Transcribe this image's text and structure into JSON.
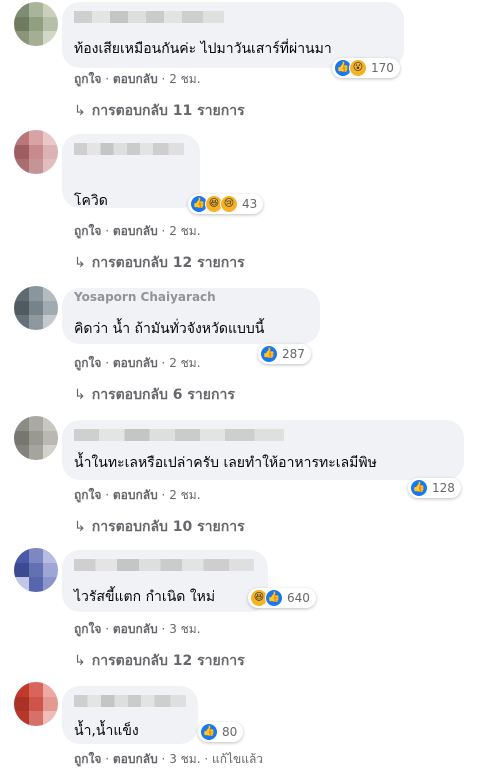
{
  "comments": [
    {
      "avatar_colors": [
        "#7d8c72",
        "#a8b59a",
        "#c9d1bd",
        "#6f7b5e",
        "#90a07f",
        "#b6c0a8",
        "#8a9579",
        "#a3ae93",
        "#d1d8c6"
      ],
      "name": "",
      "text": "ท้องเสียเหมือนกันค่ะ ไปมาวันเสาร์ที่ผ่านมา",
      "reactions": [
        "like",
        "wow"
      ],
      "reaction_count": "170",
      "like_label": "ถูกใจ",
      "reply_label": "ตอบกลับ",
      "time": "2 ชม.",
      "edited": "",
      "replies": "การตอบกลับ 11 รายการ"
    },
    {
      "avatar_colors": [
        "#b9777a",
        "#d9a3a5",
        "#e8c8c9",
        "#9d5d61",
        "#c98a8d",
        "#dcb3b4",
        "#a86e70",
        "#c49496",
        "#e2bebf"
      ],
      "name": "",
      "text": "โควิด",
      "reactions": [
        "like",
        "haha",
        "sad"
      ],
      "reaction_count": "43",
      "like_label": "ถูกใจ",
      "reply_label": "ตอบกลับ",
      "time": "2 ชม.",
      "edited": "",
      "replies": "การตอบกลับ 12 รายการ"
    },
    {
      "avatar_colors": [
        "#5f6b73",
        "#8a969d",
        "#b4bcc1",
        "#4f5a61",
        "#77838a",
        "#a0aab0",
        "#65717a",
        "#8e999f",
        "#c3c9cd"
      ],
      "name": "Yosaporn Chaiyarach",
      "text": "คิดว่า น้ำ ถ้ามันทั่วจังหวัดแบบนี้",
      "reactions": [
        "like"
      ],
      "reaction_count": "287",
      "like_label": "ถูกใจ",
      "reply_label": "ตอบกลับ",
      "time": "2 ชม.",
      "edited": "",
      "replies": "การตอบกลับ 6 รายการ"
    },
    {
      "avatar_colors": [
        "#8c8c86",
        "#aaa9a2",
        "#c8c7c0",
        "#77766f",
        "#9a9991",
        "#b9b8b1",
        "#83827b",
        "#a5a49d",
        "#d2d1cb"
      ],
      "name": "",
      "text": "น้ำในทะเลหรือเปล่าครับ เลยทำให้อาหารทะเลมีพิษ",
      "reactions": [
        "like"
      ],
      "reaction_count": "128",
      "like_label": "ถูกใจ",
      "reply_label": "ตอบกลับ",
      "time": "2 ชม.",
      "edited": "",
      "replies": "การตอบกลับ 10 รายการ"
    },
    {
      "avatar_colors": [
        "#4a5aa8",
        "#7d87c2",
        "#b7bde0",
        "#3c4a8f",
        "#6270b4",
        "#9ea6d4",
        "#c2c7e6",
        "#5866ad",
        "#8d96cb"
      ],
      "name": "",
      "text": "ไวรัสขี้แตก กำเนิด ใหม่",
      "reactions": [
        "haha",
        "like"
      ],
      "reaction_count": "640",
      "like_label": "ถูกใจ",
      "reply_label": "ตอบกลับ",
      "time": "3 ชม.",
      "edited": "",
      "replies": "การตอบกลับ 12 รายการ"
    },
    {
      "avatar_colors": [
        "#c0392b",
        "#d9645a",
        "#ecaaa4",
        "#a93226",
        "#cd5449",
        "#e39890",
        "#b8372c",
        "#d67169",
        "#f0bcb7"
      ],
      "name": "",
      "text": "น้ำ,น้ำแข็ง",
      "reactions": [
        "like"
      ],
      "reaction_count": "80",
      "like_label": "ถูกใจ",
      "reply_label": "ตอบกลับ",
      "time": "3 ชม.",
      "edited": "แก้ไขแล้ว",
      "replies": ""
    }
  ]
}
